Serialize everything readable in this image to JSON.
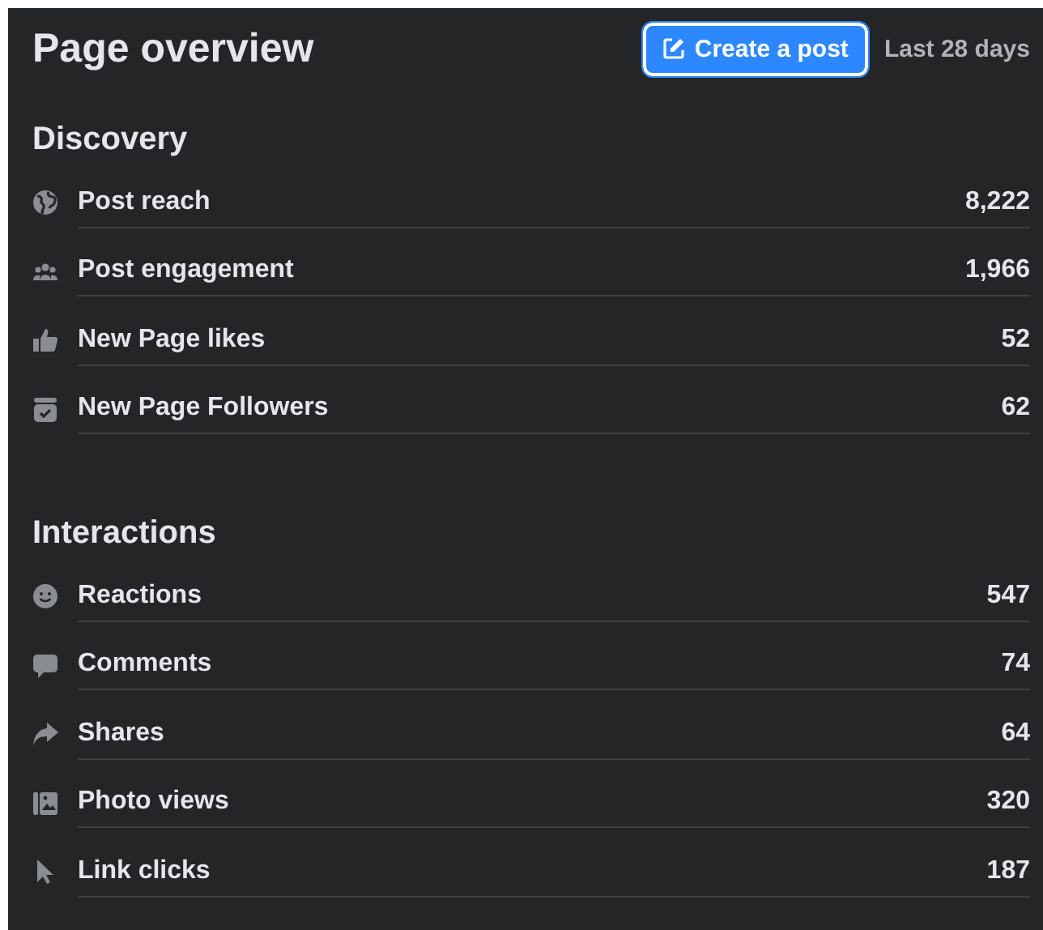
{
  "header": {
    "title": "Page overview",
    "button": "Create a post",
    "period": "Last 28 days"
  },
  "sections": [
    {
      "title": "Discovery",
      "rows": [
        {
          "label": "Post reach",
          "value": "8,222"
        },
        {
          "label": "Post engagement",
          "value": "1,966"
        },
        {
          "label": "New Page likes",
          "value": "52"
        },
        {
          "label": "New Page Followers",
          "value": "62"
        }
      ]
    },
    {
      "title": "Interactions",
      "rows": [
        {
          "label": "Reactions",
          "value": "547"
        },
        {
          "label": "Comments",
          "value": "74"
        },
        {
          "label": "Shares",
          "value": "64"
        },
        {
          "label": "Photo views",
          "value": "320"
        },
        {
          "label": "Link clicks",
          "value": "187"
        }
      ]
    }
  ]
}
